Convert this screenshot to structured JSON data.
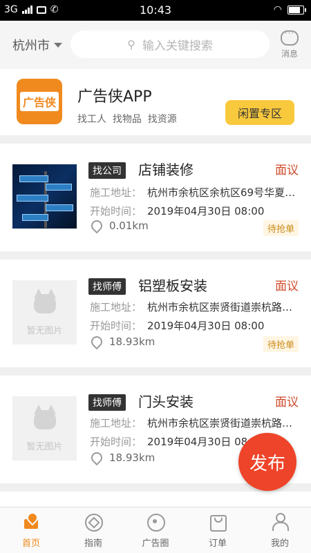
{
  "status_bar": {
    "network": "3G",
    "time": "10:43"
  },
  "header": {
    "city": "杭州市",
    "search_placeholder": "输入关键搜索",
    "message_label": "消息"
  },
  "banner": {
    "app_name": "广告侠APP",
    "logo_text": "广告侠",
    "subtitle": "找工人  找物品  找资源",
    "idle_button": "闲置专区"
  },
  "listings": [
    {
      "tag": "找公司",
      "title": "店铺装修",
      "price": "面议",
      "address_label": "施工地址：",
      "address": "杭州市余杭区余杭区69号华夏…",
      "time_label": "开始时间：",
      "start_time": "2019年04月30日 08:00",
      "distance": "0.01km",
      "status": "待抢单",
      "thumb_text": ""
    },
    {
      "tag": "找师傅",
      "title": "铝塑板安装",
      "price": "面议",
      "address_label": "施工地址：",
      "address": "杭州市余杭区崇贤街道崇杭路与…",
      "time_label": "开始时间：",
      "start_time": "2019年04月30日 08:00",
      "distance": "18.93km",
      "status": "待抢单",
      "thumb_text": "暂无图片"
    },
    {
      "tag": "找师傅",
      "title": "门头安装",
      "price": "面议",
      "address_label": "施工地址：",
      "address": "杭州市余杭区崇贤街道崇杭路与…",
      "time_label": "开始时间：",
      "start_time": "2019年04月30日 08:00",
      "distance": "18.93km",
      "status": "",
      "thumb_text": "暂无图片"
    }
  ],
  "fab_label": "发布",
  "tabs": [
    {
      "label": "首页",
      "icon": "home-map-icon",
      "active": true
    },
    {
      "label": "指南",
      "icon": "compass-icon",
      "active": false
    },
    {
      "label": "广告圈",
      "icon": "target-icon",
      "active": false
    },
    {
      "label": "订单",
      "icon": "bag-icon",
      "active": false
    },
    {
      "label": "我的",
      "icon": "user-icon",
      "active": false
    }
  ],
  "colors": {
    "accent": "#f08a1e",
    "price": "#d04a2a",
    "fab": "#ee4429",
    "idle_button": "#f8c93d"
  }
}
